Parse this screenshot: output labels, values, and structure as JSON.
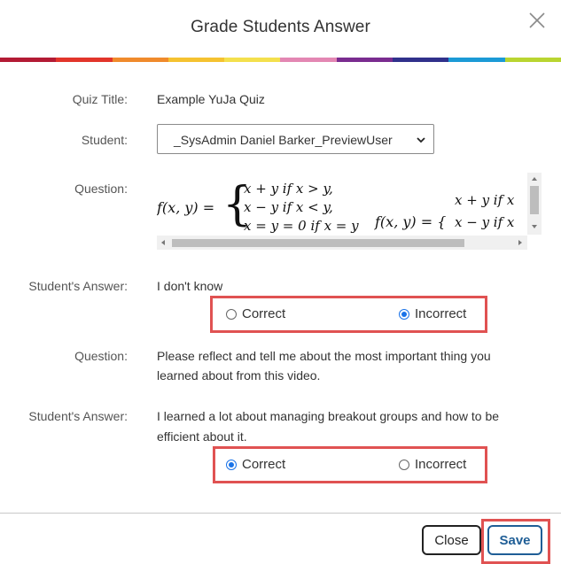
{
  "dialog": {
    "title": "Grade Students Answer",
    "rainbow_colors": [
      "#b31b34",
      "#e2352b",
      "#f08a2c",
      "#f5c230",
      "#f4e04d",
      "#e387b3",
      "#7a2c8f",
      "#30318b",
      "#1c9ad6",
      "#b9d531"
    ]
  },
  "fields": {
    "quiz_title_label": "Quiz Title:",
    "quiz_title_value": "Example YuJa Quiz",
    "student_label": "Student:",
    "student_value": "_SysAdmin Daniel Barker_PreviewUser",
    "question_label": "Question:"
  },
  "q1": {
    "formula_lhs": "f(x, y) =",
    "cases": [
      "x + y if x > y,",
      "x − y if x < y,",
      "x = y = 0 if x = y"
    ],
    "overflow_lhs": "f(x, y) = {",
    "overflow_cases": [
      "x + y if x",
      "x − y if x"
    ],
    "answer_label": "Student's Answer:",
    "answer_text": "I don't know",
    "correct_label": "Correct",
    "incorrect_label": "Incorrect",
    "selected": "Incorrect"
  },
  "q2": {
    "question_label": "Question:",
    "question_line1": "Please reflect and tell me about the most important thing you",
    "question_line2": "learned about from this video.",
    "answer_label": "Student's Answer:",
    "answer_line1": "I learned a lot about managing breakout groups and how to be",
    "answer_line2": "efficient about it.",
    "correct_label": "Correct",
    "incorrect_label": "Incorrect",
    "selected": "Correct"
  },
  "footer": {
    "close_label": "Close",
    "save_label": "Save"
  }
}
